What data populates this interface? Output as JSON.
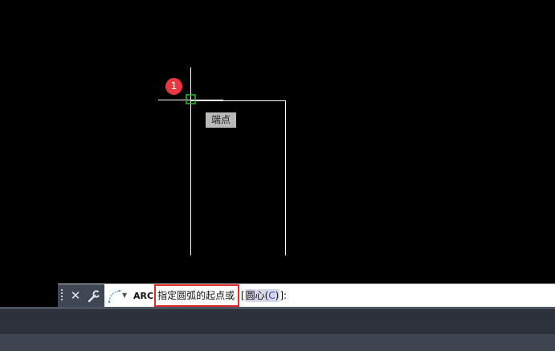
{
  "canvas": {
    "background": "#000000",
    "line_color": "#ffffff",
    "snap_marker_color": "#2fbf2f",
    "step_badge": "1",
    "snap_tooltip": "端点"
  },
  "command_line": {
    "close_icon": "close-icon",
    "settings_icon": "wrench-icon",
    "recent_commands_icon": "arc-icon",
    "command_name": "ARC",
    "prompt_text": "指定圆弧的起点或",
    "bracket_open": "[",
    "option_label": "圆心(",
    "option_key": "C",
    "option_close": ")",
    "bracket_close": "]:",
    "highlight_color": "#e02b2b"
  }
}
